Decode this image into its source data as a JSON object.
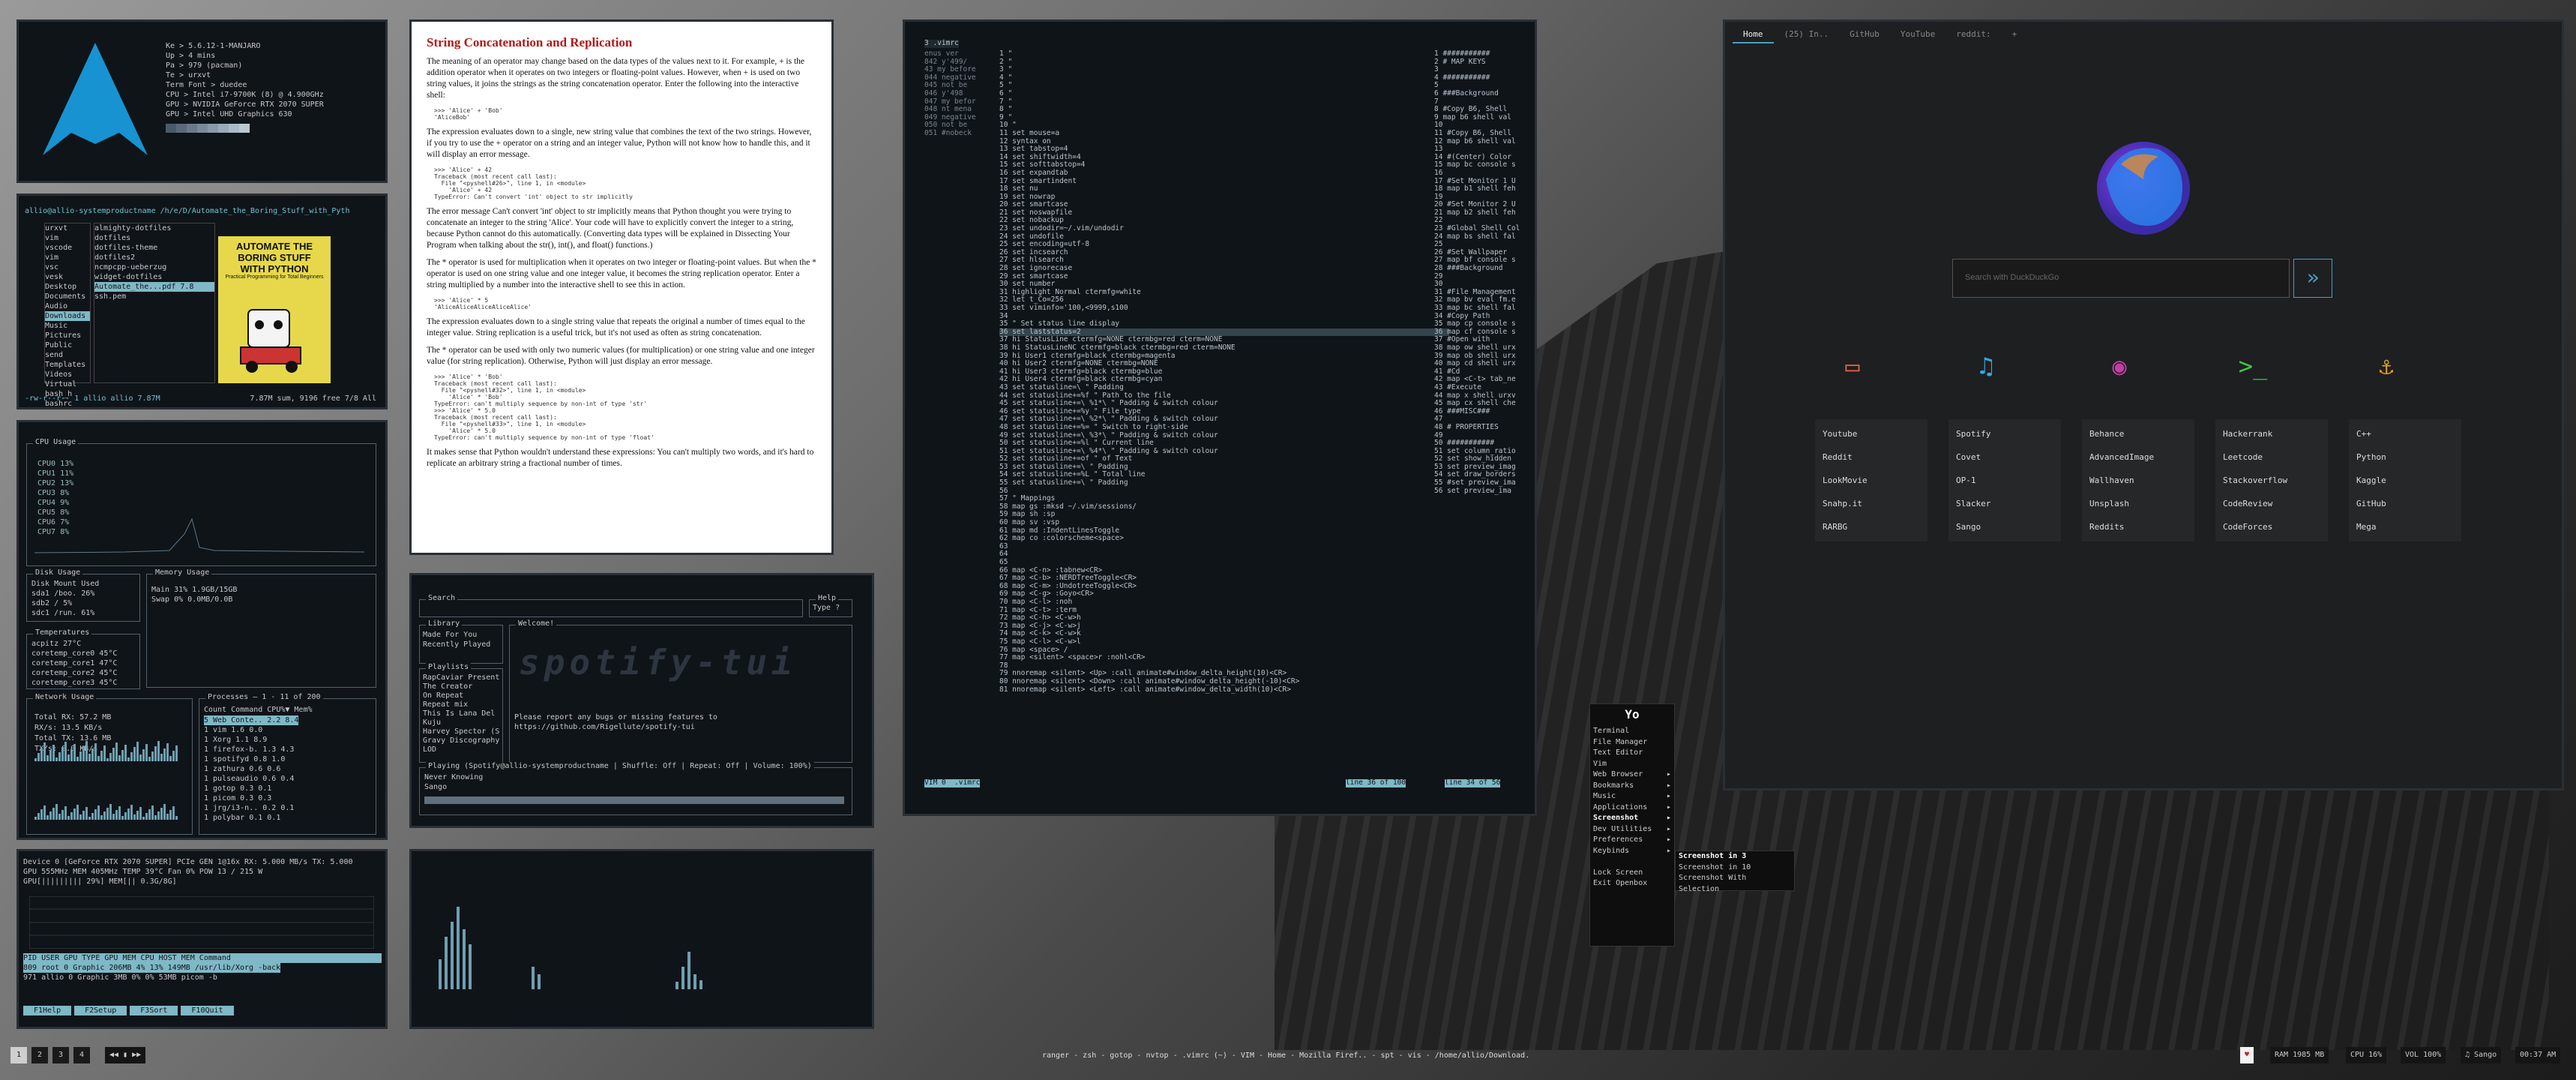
{
  "neofetch": {
    "lines": [
      "Ke > 5.6.12-1-MANJARO",
      "Up > 4 mins",
      "Pa > 979 (pacman)",
      "Te > urxvt",
      "Term Font > duedee",
      "CPU > Intel i7-9700K (8) @ 4.900GHz",
      "GPU > NVIDIA GeForce RTX 2070 SUPER",
      "GPU > Intel UHD Graphics 630"
    ]
  },
  "ranger": {
    "path": "allio@allio-systemproductname /h/e/D/Automate_the_Boring_Stuff_with_Pyth",
    "col1": [
      "urxvt",
      "vim",
      "vscode",
      "vim",
      "vsc",
      "vesk",
      "Desktop",
      "Documents",
      "Audio",
      "Downloads",
      "Music",
      "Pictures",
      "Public",
      "send",
      "Templates",
      "Videos",
      "Virtual",
      "bash_h",
      "bashrc"
    ],
    "col2": [
      "almighty-dotfiles",
      "dotfiles",
      "dotfiles-theme",
      "dotfiles2",
      "ncmpcpp-ueberzug",
      "widget-dotfiles",
      "Automate_the...pdf 7.8",
      "ssh.pem"
    ],
    "col2_sizes": [
      "17",
      "14",
      "15",
      "14",
      "9",
      "16",
      "7",
      "1.65 K"
    ],
    "book": {
      "title": "AUTOMATE THE BORING STUFF WITH PYTHON",
      "sub": "Practical Programming for Total Beginners"
    },
    "status": "-rw-r--r-- 1 allio allio 7.87M",
    "status_right": "7.87M sum, 9196 free   7/8   All"
  },
  "gotop": {
    "cpu_title": "CPU Usage",
    "cpus": [
      "CPU0 13%",
      "CPU1 11%",
      "CPU2 13%",
      "CPU3 8%",
      "CPU4 9%",
      "CPU5 8%",
      "CPU6 7%",
      "CPU7 8%"
    ],
    "disk_title": "Disk Usage",
    "disk_header": "Disk  Mount  Used",
    "disks": [
      "sda1  /boo.  26%",
      "sdb2  /      5%",
      "sdc1  /run.  61%"
    ],
    "mem_title": "Memory Usage",
    "mem": [
      "Main  31%  1.9GB/15GB",
      "Swap  0%   0.0MB/0.0B"
    ],
    "temp_title": "Temperatures",
    "temps": [
      "acpitz 27°C",
      "coretemp_core0 45°C",
      "coretemp_core1 47°C",
      "coretemp_core2 45°C",
      "coretemp_core3 45°C"
    ],
    "net_title": "Network Usage",
    "net": [
      "Total RX: 57.2 MB",
      "RX/s: 13.5 KB/s",
      "Total TX: 13.6 MB",
      "TX/s: 0.0 KB/s"
    ],
    "proc_title": "Processes — 1 - 11 of 200",
    "proc_header": "Count  Command     CPU%▼  Mem%",
    "procs": [
      "5  Web Conte..  2.2  8.4",
      "1  vim         1.6  0.0",
      "1  Xorg        1.1  8.9",
      "1  firefox-b.  1.3  4.3",
      "1  spotifyd    0.8  1.0",
      "1  zathura     0.6  0.6",
      "1  pulseaudio  0.6  0.4",
      "1  gotop       0.3  0.1",
      "1  picom       0.3  0.3",
      "1  jrg/i3-n..  0.2  0.1",
      "1  polybar     0.1  0.1"
    ]
  },
  "nvtop": {
    "line1": "Device 0 [GeForce RTX 2070 SUPER] PCIe GEN 1@16x RX: 5.000 MB/s TX: 5.000",
    "line2": "GPU 555MHz  MEM 405MHz  TEMP 39°C Fan 0% POW 13 / 215 W",
    "line3": "GPU[|||||||||           29%] MEM[||                 0.3G/8G]",
    "header": " PID USER GPU  TYPE    GPU MEM  CPU  HOST MEM Command",
    "procs": [
      " 809 root  0 Graphic   206MB  4%   13%  149MB /usr/lib/Xorg -back",
      " 971 allio  0 Graphic    3MB  0%   0%   53MB picom -b"
    ],
    "footer": [
      "F1Help",
      "F2Setup",
      "F3Sort",
      "F10Quit"
    ]
  },
  "article": {
    "title": "String Concatenation and Replication",
    "p1": "The meaning of an operator may change based on the data types of the values next to it. For example, + is the addition operator when it operates on two integers or floating-point values. However, when + is used on two string values, it joins the strings as the string concatenation operator. Enter the following into the interactive shell:",
    "c1": ">>> 'Alice' + 'Bob'\n'AliceBob'",
    "p2": "The expression evaluates down to a single, new string value that combines the text of the two strings. However, if you try to use the + operator on a string and an integer value, Python will not know how to handle this, and it will display an error message.",
    "c2": ">>> 'Alice' + 42\nTraceback (most recent call last):\n  File \"<pyshell#26>\", line 1, in <module>\n    'Alice' + 42\nTypeError: Can't convert 'int' object to str implicitly",
    "p3": "The error message Can't convert 'int' object to str implicitly means that Python thought you were trying to concatenate an integer to the string 'Alice'. Your code will have to explicitly convert the integer to a string, because Python cannot do this automatically. (Converting data types will be explained in Dissecting Your Program when talking about the str(), int(), and float() functions.)",
    "p4": "The * operator is used for multiplication when it operates on two integer or floating-point values. But when the * operator is used on one string value and one integer value, it becomes the string replication operator. Enter a string multiplied by a number into the interactive shell to see this in action.",
    "c3": ">>> 'Alice' * 5\n'AliceAliceAliceAliceAlice'",
    "p5": "The expression evaluates down to a single string value that repeats the original a number of times equal to the integer value. String replication is a useful trick, but it's not used as often as string concatenation.",
    "p6": "The * operator can be used with only two numeric values (for multiplication) or one string value and one integer value (for string replication). Otherwise, Python will just display an error message.",
    "c4": ">>> 'Alice' * 'Bob'\nTraceback (most recent call last):\n  File \"<pyshell#32>\", line 1, in <module>\n    'Alice' * 'Bob'\nTypeError: can't multiply sequence by non-int of type 'str'\n>>> 'Alice' * 5.0\nTraceback (most recent call last):\n  File \"<pyshell#33>\", line 1, in <module>\n    'Alice' * 5.0\nTypeError: can't multiply sequence by non-int of type 'float'",
    "p7": "It makes sense that Python wouldn't understand these expressions: You can't multiply two words, and it's hard to replicate an arbitrary string a fractional number of times."
  },
  "spotify": {
    "search_label": "Search",
    "help_label": "Help",
    "help_value": "Type ?",
    "library_label": "Library",
    "library": [
      "Made For You",
      "Recently Played"
    ],
    "welcome_label": "Welcome!",
    "playlists_label": "Playlists",
    "playlists": [
      "RapCaviar Present",
      "The Creator",
      "On Repeat",
      "Repeat mix",
      "This Is Lana Del",
      "Kuju",
      "Harvey Spector (S",
      "Gravy Discography",
      "LOD"
    ],
    "banner": "spotify-tui",
    "welcome_text": "Please report any bugs or missing features to https://github.com/Rigellute/spotify-tui",
    "playing": "Playing (Spotify@allio-systemproductname | Shuffle: Off | Repeat: Off | Volume: 100%)",
    "track": "Never Knowing",
    "artist": "Sango"
  },
  "vim": {
    "tabline": "3 .vimrc",
    "left_col": [
      "enus ver",
      "842 y'499/",
      "43 my before",
      "044 negative",
      "045 not be",
      "046 y'498",
      "047 my befor",
      "048 nt mena",
      "049 negative",
      "050 not be",
      "051 #nobeck"
    ],
    "mid": [
      "1 \"",
      "2 \"",
      "3 \"",
      "4 \"",
      "5 \"",
      "6 \"",
      "7 \"",
      "8 \"",
      "9 \"",
      "10 \"",
      "11 set mouse=a",
      "12 syntax on",
      "13 set tabstop=4",
      "14 set shiftwidth=4",
      "15 set softtabstop=4",
      "16 set expandtab",
      "17 set smartindent",
      "18 set nu",
      "19 set nowrap",
      "20 set smartcase",
      "21 set noswapfile",
      "22 set nobackup",
      "23 set undodir=~/.vim/undodir",
      "24 set undofile",
      "25 set encoding=utf-8",
      "26 set incsearch",
      "27 set hlsearch",
      "28 set ignorecase",
      "29 set smartcase",
      "30 set number",
      "31 highlight Normal ctermfg=white",
      "32 let t_Co=256",
      "33 set viminfo='100,<9999,s100",
      "34",
      "35 \" Set status line display",
      "36 set laststatus=2",
      "37 hi StatusLine ctermfg=NONE ctermbg=red cterm=NONE",
      "38 hi StatusLineNC ctermfg=black ctermbg=red cterm=NONE",
      "39 hi User1 ctermfg=black ctermbg=magenta",
      "40 hi User2 ctermfg=NONE ctermbg=NONE",
      "41 hi User3 ctermfg=black ctermbg=blue",
      "42 hi User4 ctermfg=black ctermbg=cyan",
      "43 set statusline=\\     \" Padding",
      "44 set statusline+=%f         \" Path to the file",
      "45 set statusline+=\\ %1*\\   \" Padding & switch colour",
      "46 set statusline+=%y        \" File type",
      "47 set statusline+=\\ %2*\\   \" Padding & switch colour",
      "48 set statusline+=%=        \" Switch to right-side",
      "49 set statusline+=\\ %3*\\   \" Padding & switch colour",
      "50 set statusline+=%l        \" Current line",
      "51 set statusline+=\\ %4*\\   \" Padding & switch colour",
      "52 set statusline+=of        \" of Text",
      "53 set statusline+=\\        \" Padding",
      "54 set statusline+=%L        \" Total line",
      "55 set statusline+=\\        \" Padding",
      "56",
      "57 \" Mappings",
      "58 map gs :mksd ~/.vim/sessions/",
      "59 map sh :sp",
      "60 map sv :vsp",
      "61 map md :IndentLinesToggle",
      "62 map co :colorscheme<space>",
      "63",
      "64",
      "65",
      "66 map <C-n> :tabnew<CR>",
      "67 map <C-b> :NERDTreeToggle<CR>",
      "68 map <C-m> :UndotreeToggle<CR>",
      "69 map <C-g> :Goyo<CR>",
      "70 map <C-l> :noh",
      "71 map <C-t> :term",
      "72 map <C-h> <C-w>h",
      "73 map <C-j> <C-w>j",
      "74 map <C-k> <C-w>k",
      "75 map <C-l> <C-w>l",
      "76 map <space> /",
      "77 map <silent> <space>r :nohl<CR>",
      "78",
      "79 nnoremap <silent> <Up>   :call animate#window_delta_height(10)<CR>",
      "80 nnoremap <silent> <Down> :call animate#window_delta_height(-10)<CR>",
      "81 nnoremap <silent> <Left> :call animate#window_delta_width(10)<CR>"
    ],
    "right": [
      "1 ###########",
      "2 # MAP KEYS",
      "3 ",
      "4 ###########",
      "5 ",
      "6 ###Background",
      "7 ",
      "8 #Copy B6, Shell",
      "9 map b6 shell val",
      "10 ",
      "11 #Copy B6, Shell",
      "12 map b6 shell val",
      "13 ",
      "14 #(Center) Color",
      "15 map bc console s",
      "16 ",
      "17 #Set Monitor 1 U",
      "18 map b1 shell feh",
      "19 ",
      "20 #Set Monitor 2 U",
      "21 map b2 shell feh",
      "22 ",
      "23 #Global Shell Col",
      "24 map bs shell fal",
      "25 ",
      "26 #Set Wallpaper",
      "27 map bf console s",
      "28 ###Background",
      "29 ",
      "30 ",
      "31 #File Management",
      "32 map bv eval fm.e",
      "33 map bc shell fal",
      "34 #Copy Path",
      "35 map cp console s",
      "36 map cf console s",
      "37 #Open with",
      "38 map ow shell urx",
      "39 map ob shell urx",
      "40 map cd shell urx",
      "41 #Cd",
      "42 map <C-t> tab_ne",
      "43 #Execute",
      "44 map x shell urxv",
      "45 map cx shell che",
      "46 ###MISC###",
      "47 ",
      "48 # PROPERTIES",
      "49 ",
      "50 ###########",
      "51 set column_ratio",
      "52 set show_hidden",
      "53 set preview_imag",
      "54 set draw_borders",
      "55 #set preview_ima",
      "56 set preview_ima"
    ],
    "status_left": "VIM 0  .vimrc",
    "status_right": "line 36 of 100",
    "status_right2": "line 34 of 56"
  },
  "statusbar": {
    "center": "ranger - zsh - gotop - nvtop - .vimrc (~) - VIM - Home - Mozilla Firef.. - spt - vis - /home/allio/Download.",
    "workspaces": [
      "1",
      "2",
      "3",
      "4"
    ],
    "layout": "◀◀ ▮ ▶▶",
    "right": [
      "♥",
      "RAM 1985 MB",
      "CPU 16%",
      "VOL 100%",
      "♫ Sango",
      "00:37 AM"
    ]
  },
  "browser": {
    "tabs": [
      "Home",
      "(25) In..",
      "GitHub",
      "YouTube",
      "reddit:"
    ],
    "new_tab": "+",
    "search_placeholder": "Search with DuckDuckGo",
    "go": "»",
    "columns": [
      [
        "Youtube",
        "Reddit",
        "LookMovie",
        "Snahp.it",
        "RARBG"
      ],
      [
        "Spotify",
        "Covet",
        "OP-1",
        "Slacker",
        "Sango"
      ],
      [
        "Behance",
        "AdvancedImage",
        "Wallhaven",
        "Unsplash",
        "Reddits"
      ],
      [
        "Hackerrank",
        "Leetcode",
        "Stackoverflow",
        "CodeReview",
        "CodeForces"
      ],
      [
        "C++",
        "Python",
        "Kaggle",
        "GitHub",
        "Mega"
      ]
    ],
    "col_icons": [
      "tv-icon",
      "music-icon",
      "eye-icon",
      "terminal-icon",
      "anchor-icon"
    ],
    "icon_colors": [
      "#e8614d",
      "#3aa6e0",
      "#c23ea5",
      "#3ec94a",
      "#e0a024"
    ]
  },
  "jgmenu": {
    "title": "Yo",
    "items": [
      "Terminal",
      "File Manager",
      "Text Editor",
      "Vim",
      "Web Browser",
      "Bookmarks",
      "Music",
      "Applications",
      "Screenshot",
      "Dev Utilities",
      "Preferences",
      "Keybinds",
      "",
      "Lock Screen",
      "Exit Openbox"
    ],
    "arrows": [
      "",
      "",
      "",
      "",
      "▸",
      "▸",
      "▸",
      "▸",
      "▸",
      "▸",
      "▸",
      "▸",
      "",
      "",
      ""
    ],
    "sub": [
      "Screenshot in 3",
      "Screenshot in 10",
      "Screenshot With Selection"
    ]
  }
}
